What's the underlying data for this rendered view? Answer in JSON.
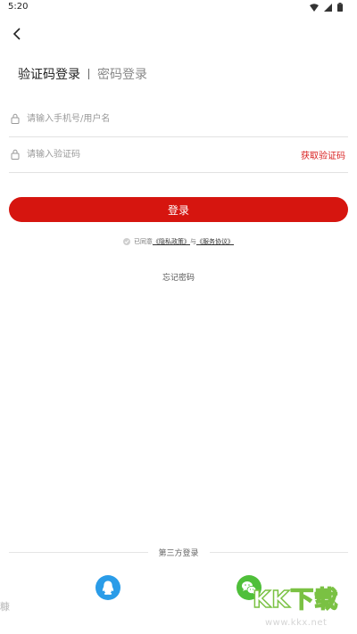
{
  "status_bar": {
    "time": "5:20"
  },
  "tabs": {
    "active": "验证码登录",
    "inactive": "密码登录"
  },
  "phone_field": {
    "placeholder": "请输入手机号/用户名",
    "value": ""
  },
  "code_field": {
    "placeholder": "请输入验证码",
    "value": "",
    "get_code_label": "获取验证码"
  },
  "login_button": {
    "label": "登录",
    "color": "#d6150f"
  },
  "agreement": {
    "prefix": "已同意",
    "privacy_link": "《隐私政策》",
    "connector": "与",
    "service_link": "《服务协议》"
  },
  "forgot_password": "忘记密码",
  "third_party": {
    "label": "第三方登录",
    "providers": [
      {
        "name": "qq-icon",
        "color": "#2a9ce8"
      },
      {
        "name": "wechat-icon",
        "color": "#4fbf3a"
      }
    ]
  },
  "watermark": {
    "logo": "KK下载",
    "url": "www.kkx.net",
    "left_fragment": "糠"
  },
  "colors": {
    "accent": "#d81e1e"
  }
}
